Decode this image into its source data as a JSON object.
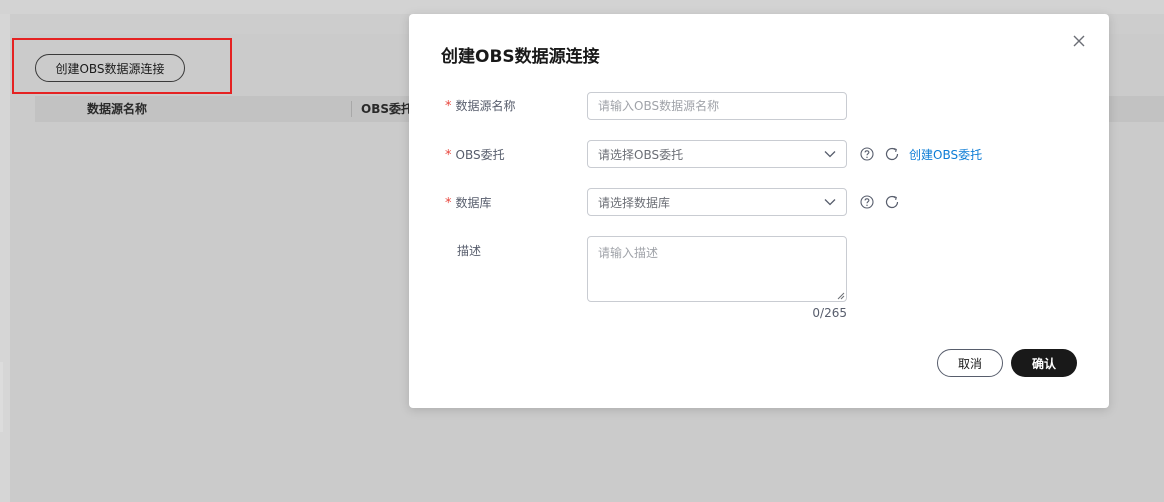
{
  "background": {
    "create_button_label": "创建OBS数据源连接",
    "table_columns": [
      "数据源名称",
      "OBS委托"
    ]
  },
  "dialog": {
    "title": "创建OBS数据源连接",
    "fields": {
      "name": {
        "label": "数据源名称",
        "required": "*",
        "placeholder": "请输入OBS数据源名称",
        "value": ""
      },
      "delegation": {
        "label": "OBS委托",
        "required": "*",
        "placeholder": "请选择OBS委托",
        "link": "创建OBS委托"
      },
      "database": {
        "label": "数据库",
        "required": "*",
        "placeholder": "请选择数据库"
      },
      "description": {
        "label": "描述",
        "placeholder": "请输入描述",
        "counter": "0/265"
      }
    },
    "buttons": {
      "cancel": "取消",
      "confirm": "确认"
    }
  },
  "colors": {
    "required": "#e8453c",
    "link": "#0d7dd6",
    "primary": "#191919",
    "highlight": "#e52222"
  },
  "icons": [
    "close-icon",
    "chevron-down-icon",
    "help-icon",
    "refresh-icon",
    "resize-icon"
  ]
}
